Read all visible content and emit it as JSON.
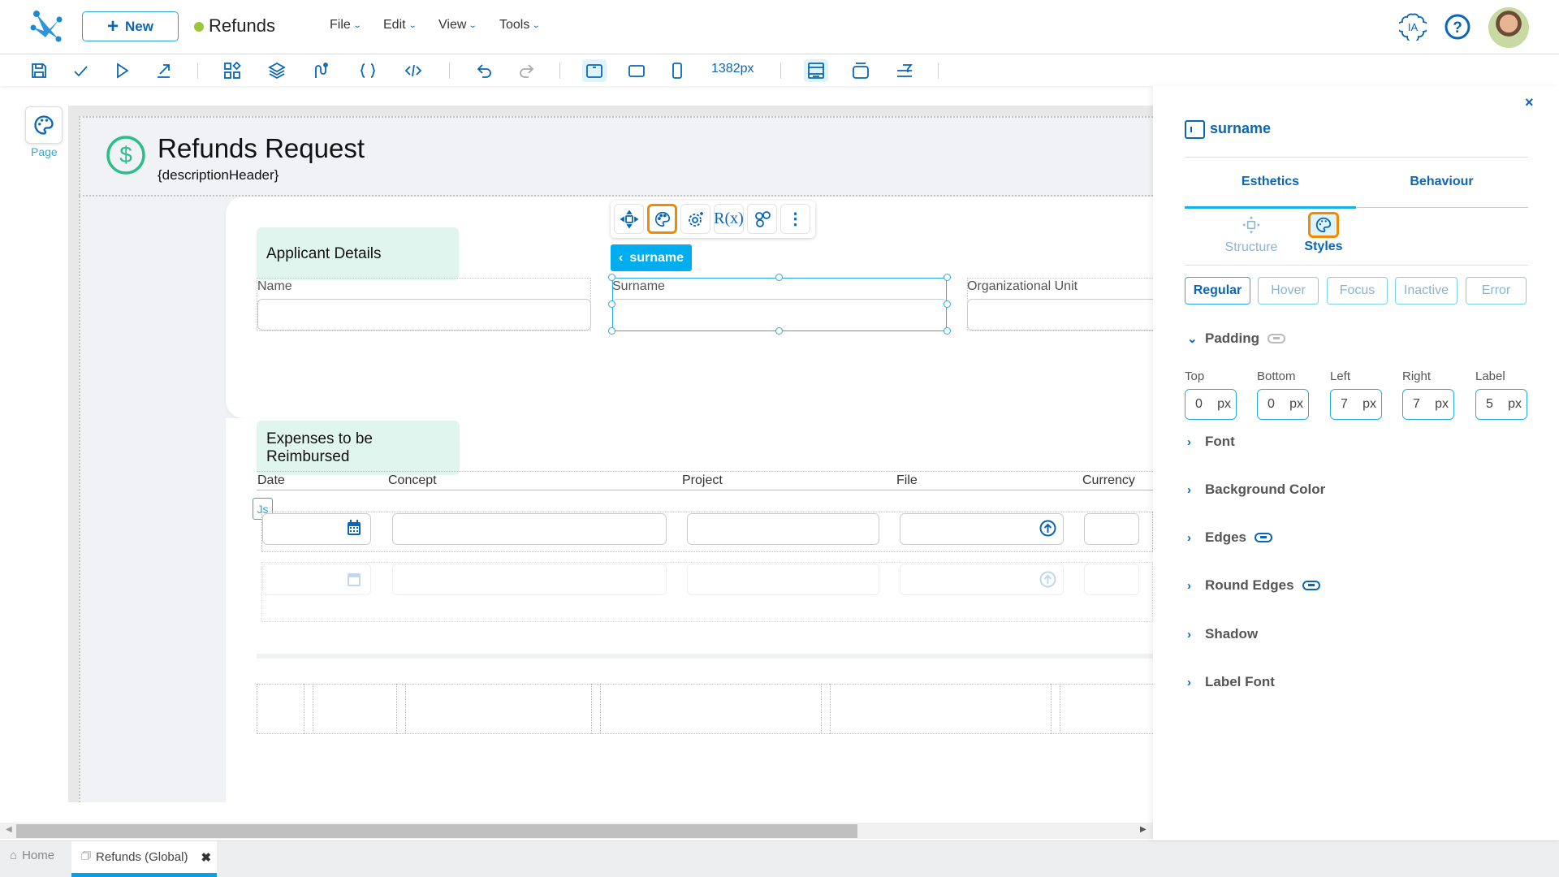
{
  "header": {
    "new_label": "New",
    "app_title": "Refunds",
    "menus": [
      "File",
      "Edit",
      "View",
      "Tools"
    ],
    "ia_label": "IA",
    "status_color": "#9bc53d"
  },
  "toolbar": {
    "width_readout": "1382px"
  },
  "left_rail": {
    "page_label": "Page"
  },
  "page": {
    "title": "Refunds Request",
    "subtitle": "{descriptionHeader}",
    "applicant_section": {
      "title": "Applicant Details",
      "fields": [
        {
          "label": "Name",
          "value": ""
        },
        {
          "label": "Surname",
          "value": ""
        },
        {
          "label": "Organizational Unit",
          "value": ""
        }
      ]
    },
    "expenses_section": {
      "title": "Expenses to be Reimbursed",
      "columns": [
        "Date",
        "Concept",
        "Project",
        "File",
        "Currency"
      ],
      "js_badge": "Js"
    }
  },
  "selection": {
    "breadcrumb": "surname",
    "context_tools": [
      "move",
      "styles",
      "settings",
      "rules",
      "connections",
      "more"
    ],
    "context_rules_label": "R(x)"
  },
  "panel": {
    "title": "surname",
    "close": "×",
    "tabs": [
      "Esthetics",
      "Behaviour"
    ],
    "active_tab": "Esthetics",
    "subtabs": [
      "Structure",
      "Styles"
    ],
    "active_subtab": "Styles",
    "states": [
      "Regular",
      "Hover",
      "Focus",
      "Inactive",
      "Error"
    ],
    "active_state": "Regular",
    "padding": {
      "title": "Padding",
      "unit": "px",
      "fields": [
        {
          "label": "Top",
          "value": "0"
        },
        {
          "label": "Bottom",
          "value": "0"
        },
        {
          "label": "Left",
          "value": "7"
        },
        {
          "label": "Right",
          "value": "7"
        },
        {
          "label": "Label",
          "value": "5"
        }
      ]
    },
    "sections": [
      "Font",
      "Background Color",
      "Edges",
      "Round Edges",
      "Shadow",
      "Label Font"
    ]
  },
  "bottom_tabs": {
    "home": "Home",
    "active": "Refunds (Global)"
  },
  "colors": {
    "brand": "#0b66b5",
    "accent": "#00adef",
    "highlight": "#f08a00",
    "chip_bg": "#dff5ee"
  }
}
